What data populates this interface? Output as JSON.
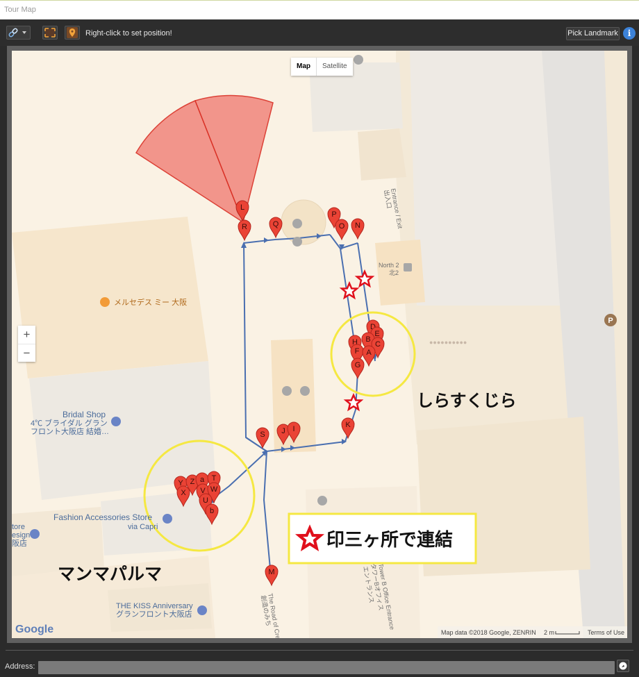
{
  "window": {
    "title": "Tour Map"
  },
  "toolbar": {
    "link_icon": "link-icon",
    "dropdown_icon": "chevron-down-icon",
    "fit_icon": "fit-bounds-icon",
    "position_icon": "pin-icon",
    "hint": "Right-click to set position!",
    "pick_landmark": "Pick Landmark",
    "info_label": "i"
  },
  "map": {
    "type_control": {
      "map": "Map",
      "satellite": "Satellite"
    },
    "zoom": {
      "in": "+",
      "out": "−"
    },
    "labels": {
      "entrance": "Entrance / Exit",
      "entrance_jp": "出入口",
      "north2": "North 2",
      "north2_jp": "北2",
      "cafe": "メルセデス ミー 大阪",
      "bridal1": "Bridal Shop",
      "bridal2": "4℃ ブライダル グラン",
      "bridal3": "フロント大阪店 結婚…",
      "fashion1": "Fashion Accessories Store",
      "fashion2": "via Capri",
      "store1": "tore",
      "store2": "esign",
      "store3": "阪店",
      "kiss1": "THE KISS Anniversary",
      "kiss2": "グランフロント大阪店",
      "office": "Tower B Office Entrance",
      "office_jp": "タワーBオフィス",
      "office_jp2": "エントランス",
      "road1": "The Road of Cre",
      "road2": "創造のみち",
      "parking": "P",
      "blurred": "●●●●●●●●●●"
    },
    "annotations": {
      "shirasu": "しらすくじら",
      "manma": "マンマパルマ",
      "connect": "印三ヶ所で連結"
    },
    "colors": {
      "route": "#4a6fb0",
      "marker": "#ea4335",
      "fov": "#f28b82",
      "circle": "#f5e842",
      "annotation_star": "#e0101c"
    },
    "markers": [
      "L",
      "R",
      "Q",
      "P",
      "O",
      "N",
      "D",
      "E",
      "B",
      "H",
      "C",
      "F",
      "A",
      "G",
      "K",
      "J",
      "I",
      "S",
      "Y",
      "Z",
      "a",
      "T",
      "X",
      "V",
      "W",
      "U",
      "b",
      "M"
    ],
    "attribution": {
      "logo": "Google",
      "data": "Map data ©2018 Google, ZENRIN",
      "scale": "2 m",
      "terms": "Terms of Use"
    }
  },
  "address": {
    "label": "Address:",
    "value": "",
    "go_icon": "compass-icon"
  }
}
